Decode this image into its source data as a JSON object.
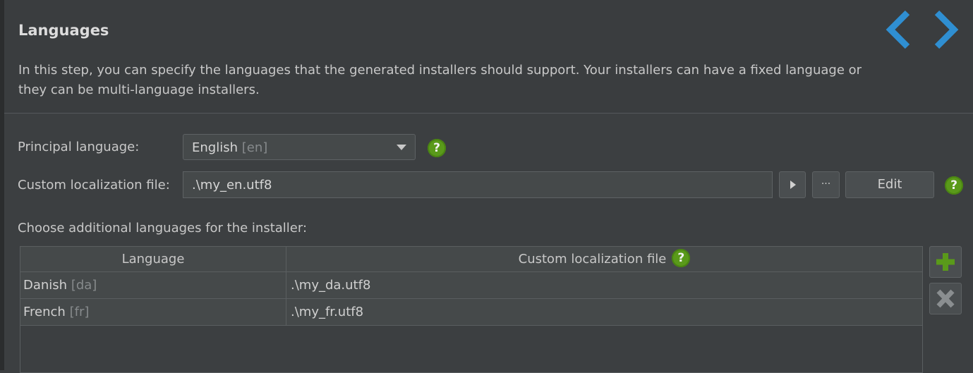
{
  "header": {
    "title": "Languages",
    "description": "In this step, you can specify the languages that the generated installers should support. Your installers can have a fixed language or they can be multi-language installers."
  },
  "principal": {
    "label": "Principal language:",
    "value": "English",
    "code": "[en]"
  },
  "custom_file": {
    "label": "Custom localization file:",
    "value": ".\\my_en.utf8",
    "browse_label": "···",
    "edit_label": "Edit"
  },
  "help_label": "?",
  "additional": {
    "label": "Choose additional languages for the installer:",
    "columns": [
      "Language",
      "Custom localization file"
    ],
    "rows": [
      {
        "language": "Danish",
        "code": "[da]",
        "file": ".\\my_da.utf8"
      },
      {
        "language": "French",
        "code": "[fr]",
        "file": ".\\my_fr.utf8"
      }
    ]
  },
  "icons": {
    "back": "chevron-left-icon",
    "forward": "chevron-right-icon",
    "add": "plus-icon",
    "remove": "x-icon"
  },
  "colors": {
    "background": "#3c3f41",
    "nav_arrow": "#2f8fd2",
    "help_green": "#5a9a1a",
    "add_green": "#5a9a1a"
  }
}
